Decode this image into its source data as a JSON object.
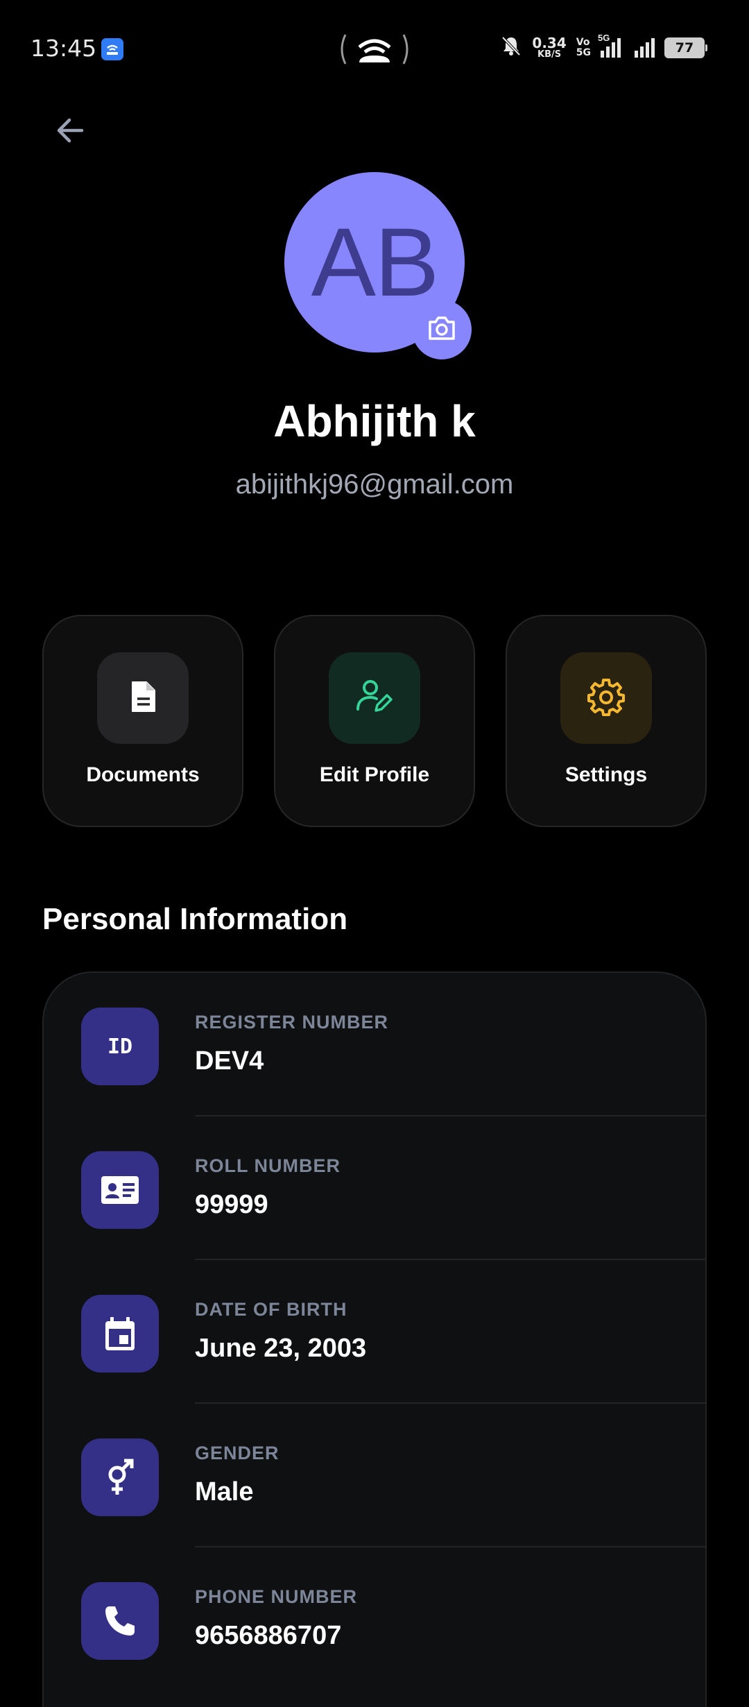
{
  "status_bar": {
    "time": "13:45",
    "net_speed_value": "0.34",
    "net_speed_unit": "KB/S",
    "volte_top": "Vo",
    "volte_bottom": "5G",
    "network_type": "5G",
    "battery": "77"
  },
  "profile": {
    "initials": "AB",
    "name": "Abhijith k",
    "email": "abijithkj96@gmail.com",
    "avatar_color": "#8886fc"
  },
  "actions": [
    {
      "label": "Documents",
      "icon": "document-icon",
      "icon_bg": "#252527",
      "icon_color": "#ffffff"
    },
    {
      "label": "Edit Profile",
      "icon": "user-edit-icon",
      "icon_bg": "#112a22",
      "icon_color": "#34d399"
    },
    {
      "label": "Settings",
      "icon": "gear-icon",
      "icon_bg": "#2a2310",
      "icon_color": "#f5b82e"
    }
  ],
  "personal_info": {
    "title": "Personal Information",
    "items": [
      {
        "label": "REGISTER NUMBER",
        "value": "DEV4",
        "icon": "id-icon",
        "icon_text": "ID"
      },
      {
        "label": "ROLL NUMBER",
        "value": "99999",
        "icon": "id-card-icon"
      },
      {
        "label": "DATE OF BIRTH",
        "value": "June 23, 2003",
        "icon": "calendar-icon"
      },
      {
        "label": "GENDER",
        "value": "Male",
        "icon": "gender-icon"
      },
      {
        "label": "PHONE NUMBER",
        "value": "9656886707",
        "icon": "phone-icon"
      }
    ]
  }
}
